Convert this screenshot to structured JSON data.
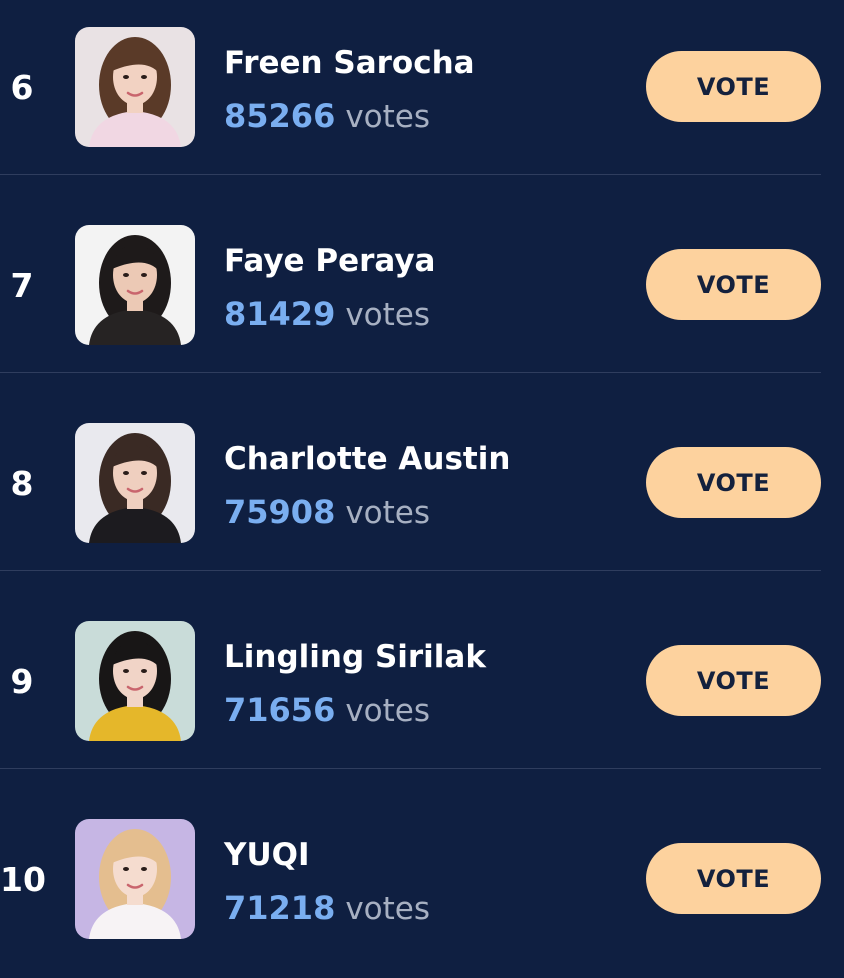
{
  "colors": {
    "background": "#0f1f41",
    "divider": "#2f3d5e",
    "vote_count": "#7aaef0",
    "vote_unit": "#a7b0c2",
    "button_bg": "#fdd29e",
    "button_text": "#14213d"
  },
  "entries": [
    {
      "rank": "6",
      "name": "Freen Sarocha",
      "votes": "85266",
      "votes_label": "votes",
      "button_label": "VOTE",
      "photo_bg": "#e9e2e4",
      "hair": "#5a3a28",
      "outfit": "#f1d7e3",
      "skin": "#f2d2c2"
    },
    {
      "rank": "7",
      "name": "Faye Peraya",
      "votes": "81429",
      "votes_label": "votes",
      "button_label": "VOTE",
      "photo_bg": "#f3f3f3",
      "hair": "#1e1a1a",
      "outfit": "#262323",
      "skin": "#ecc9b5"
    },
    {
      "rank": "8",
      "name": "Charlotte Austin",
      "votes": "75908",
      "votes_label": "votes",
      "button_label": "VOTE",
      "photo_bg": "#e9e9ee",
      "hair": "#3a2a24",
      "outfit": "#1c1b1f",
      "skin": "#efcfbf"
    },
    {
      "rank": "9",
      "name": "Lingling Sirilak",
      "votes": "71656",
      "votes_label": "votes",
      "button_label": "VOTE",
      "photo_bg": "#c9dcd9",
      "hair": "#181616",
      "outfit": "#e5b72a",
      "skin": "#f1d4c7"
    },
    {
      "rank": "10",
      "name": "YUQI",
      "votes": "71218",
      "votes_label": "votes",
      "button_label": "VOTE",
      "photo_bg": "#c6b6e4",
      "hair": "#e4be8f",
      "outfit": "#f7f3f5",
      "skin": "#f5dccf"
    }
  ]
}
